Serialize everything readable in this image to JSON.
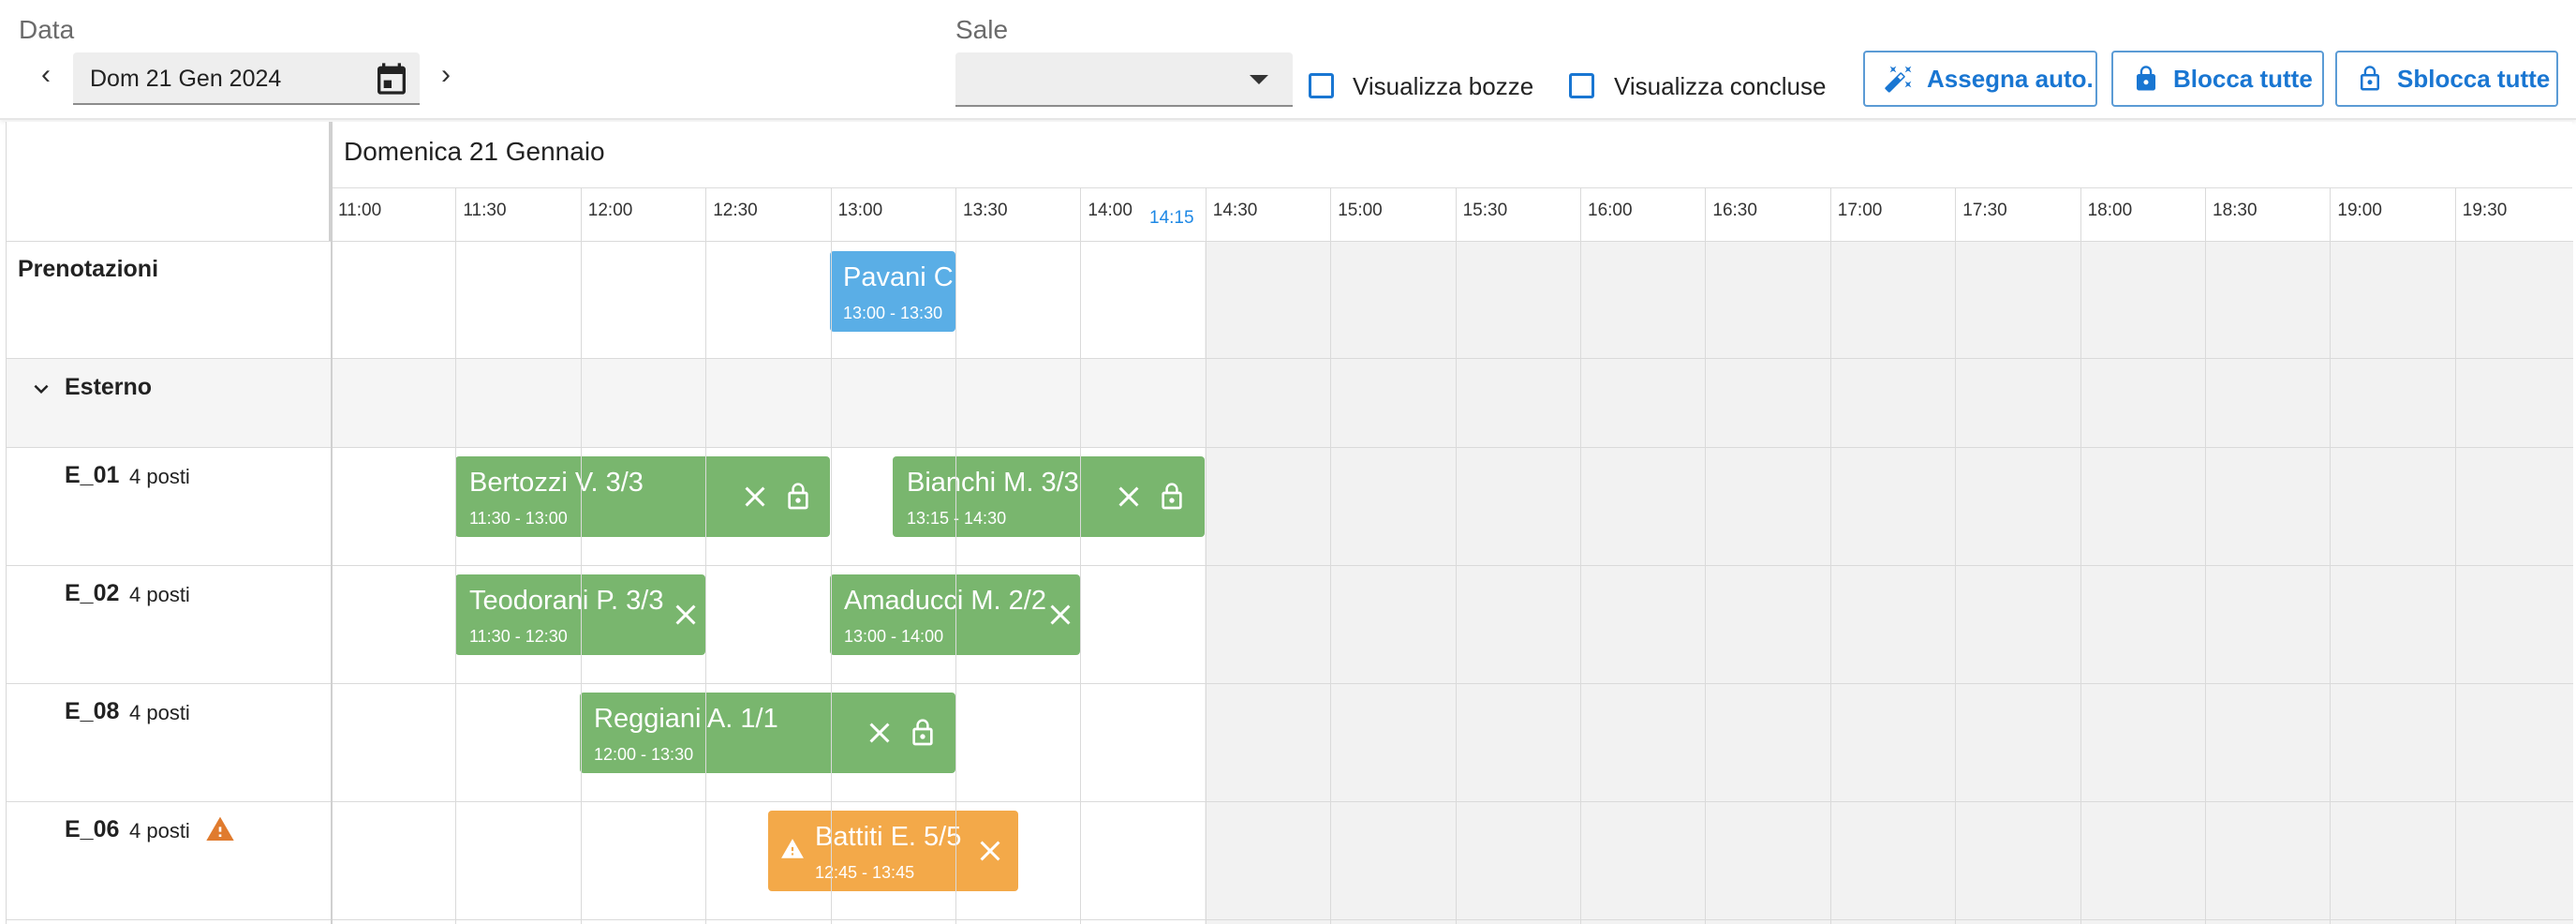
{
  "toolbar": {
    "date_label": "Data",
    "date_value": "Dom 21 Gen 2024",
    "prev_arrow": "‹",
    "next_arrow": "›",
    "sale_label": "Sale",
    "sale_value": "",
    "show_drafts_label": "Visualizza bozze",
    "show_drafts_checked": false,
    "show_completed_label": "Visualizza concluse",
    "show_completed_checked": false,
    "auto_assign_label": "Assegna auto.",
    "lock_all_label": "Blocca tutte",
    "unlock_all_label": "Sblocca tutte",
    "accent_color": "#1976d2"
  },
  "schedule": {
    "day_title": "Domenica 21 Gennaio",
    "time_slots": [
      "11:00",
      "11:30",
      "12:00",
      "12:30",
      "13:00",
      "13:30",
      "14:00",
      "14:30",
      "15:00",
      "15:30",
      "16:00",
      "16:30",
      "17:00",
      "17:30",
      "18:00",
      "18:30",
      "19:00",
      "19:30"
    ],
    "current_time": "14:15",
    "bookings_row_label": "Prenotazioni",
    "group_label": "Esterno",
    "pending_booking": {
      "name": "Pavani C.",
      "time": "13:00 - 13:30",
      "color": "#5aaee6"
    },
    "tables": [
      {
        "label": "E_01",
        "seats": "4 posti",
        "warning": false,
        "events": [
          {
            "name": "Bertozzi V. 3/3",
            "time": "11:30 - 13:00",
            "color": "#79b66e",
            "lock": true
          },
          {
            "name": "Bianchi M. 3/3",
            "time": "13:15 - 14:30",
            "color": "#79b66e",
            "lock": true
          }
        ]
      },
      {
        "label": "E_02",
        "seats": "4 posti",
        "warning": false,
        "events": [
          {
            "name": "Teodorani P. 3/3",
            "time": "11:30 - 12:30",
            "color": "#79b66e",
            "lock": false
          },
          {
            "name": "Amaducci M. 2/2",
            "time": "13:00 - 14:00",
            "color": "#79b66e",
            "lock": false
          }
        ]
      },
      {
        "label": "E_08",
        "seats": "4 posti",
        "warning": false,
        "events": [
          {
            "name": "Reggiani A. 1/1",
            "time": "12:00 - 13:30",
            "color": "#79b66e",
            "lock": true
          }
        ]
      },
      {
        "label": "E_06",
        "seats": "4 posti",
        "warning": true,
        "events": [
          {
            "name": "Battiti E. 5/5",
            "time": "12:45 - 13:45",
            "color": "#f3a949",
            "warning": true,
            "lock": false
          }
        ]
      }
    ]
  }
}
